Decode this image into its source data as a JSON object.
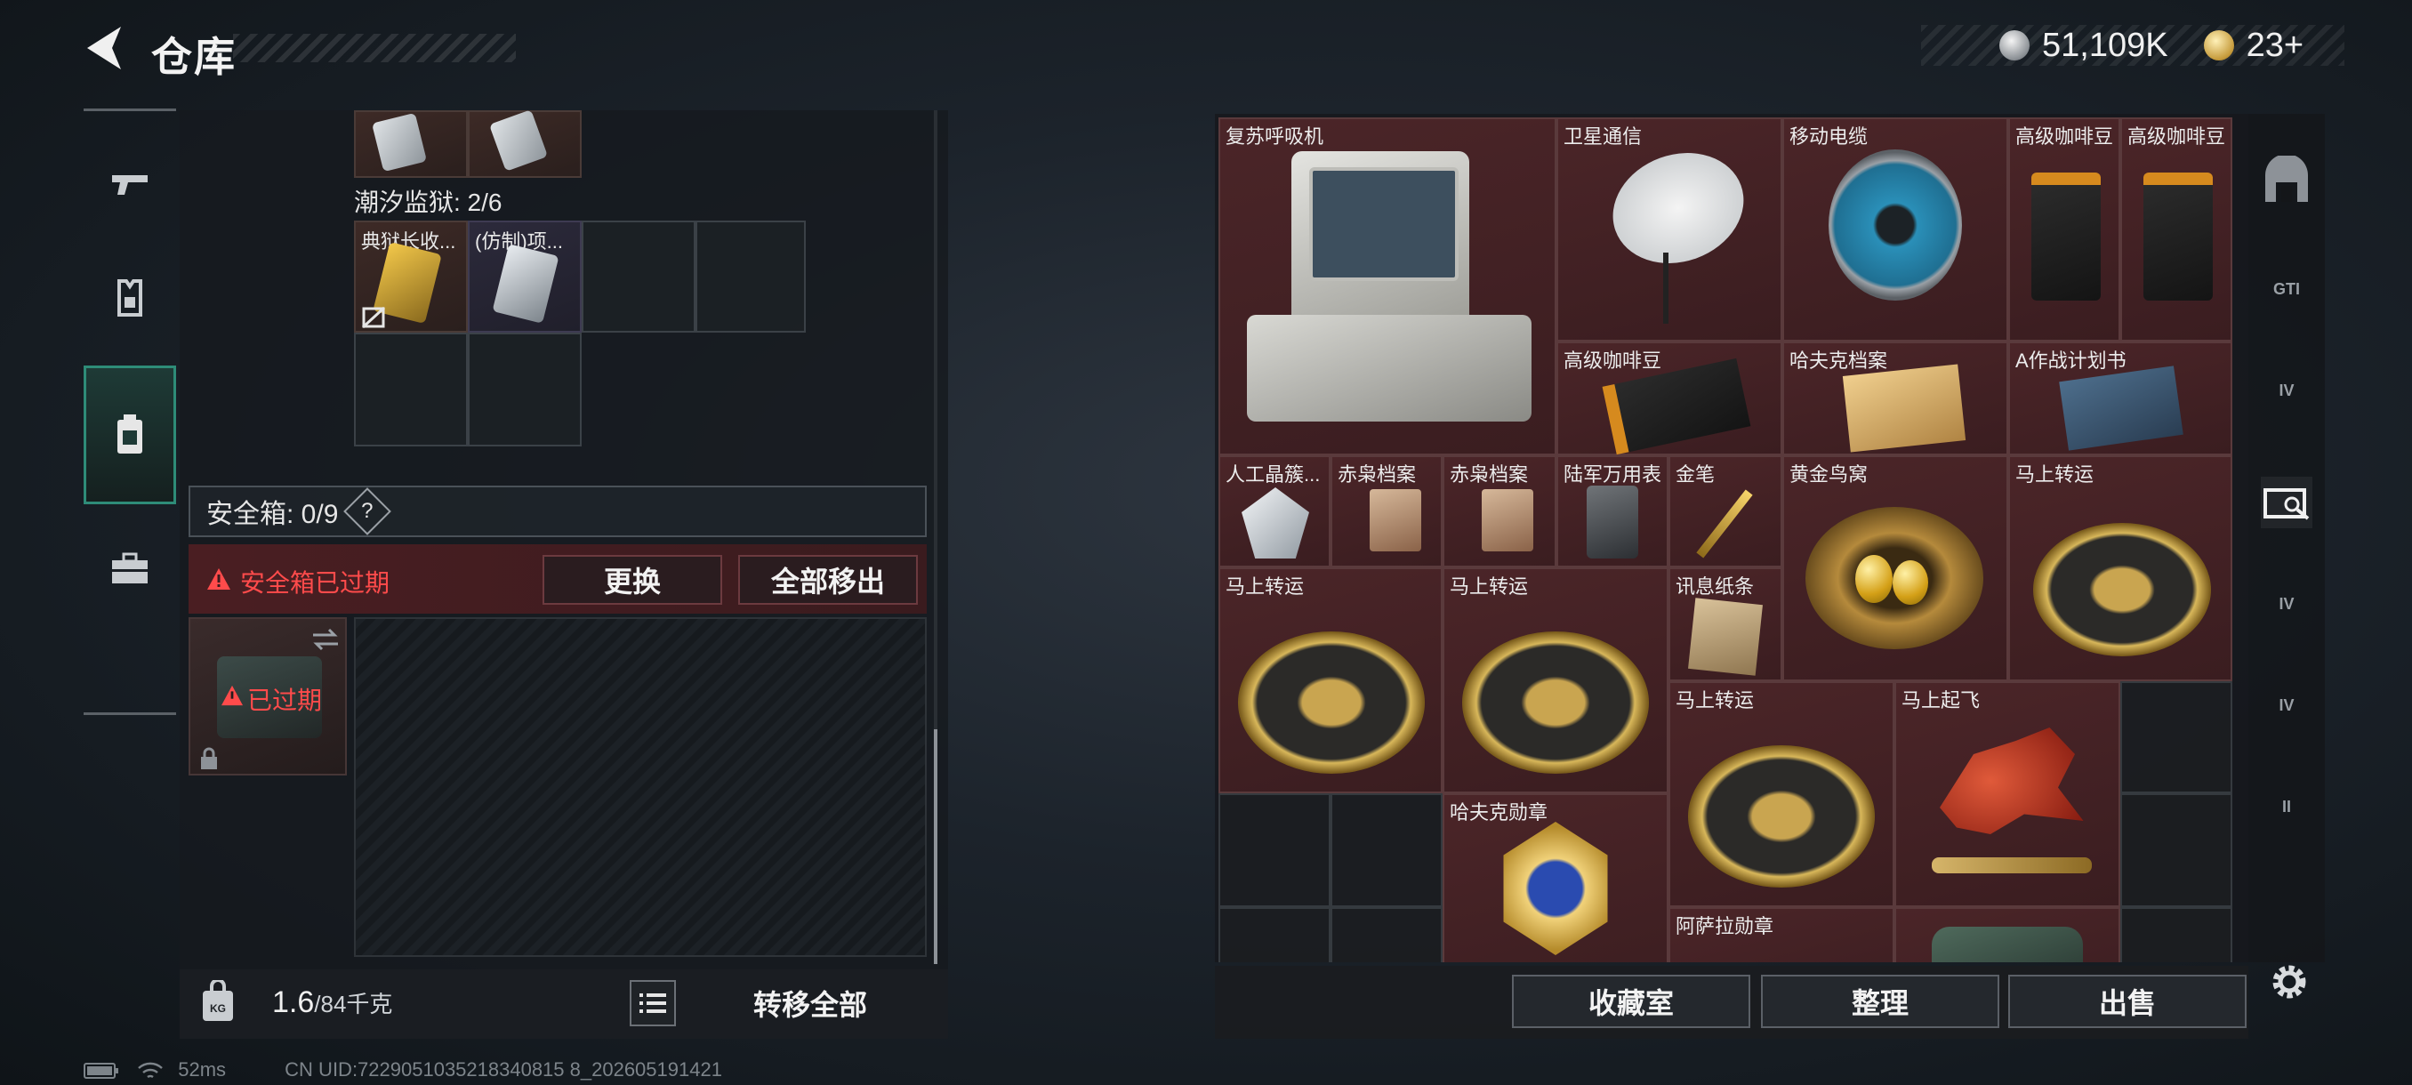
{
  "header": {
    "title": "仓库",
    "silver": "51,109K",
    "gold": "23+"
  },
  "left": {
    "group_label": "潮汐监狱: 2/6",
    "items": [
      "典狱长收...",
      "(仿制)项..."
    ],
    "safe_label": "安全箱: 0/9",
    "safe_help": "?",
    "warning": "安全箱已过期",
    "replace_btn": "更换",
    "moveall_btn": "全部移出",
    "expired_badge": "已过期",
    "weight_current": "1.6",
    "weight_max": "/84千克",
    "transfer_btn": "转移全部"
  },
  "nav": [
    {
      "icon": "gun-icon",
      "active": false
    },
    {
      "icon": "armor-icon",
      "active": false
    },
    {
      "icon": "backpack-icon",
      "active": true
    },
    {
      "icon": "toolbox-icon",
      "active": false
    }
  ],
  "stash": {
    "items": [
      "复苏呼吸机",
      "卫星通信",
      "移动电缆",
      "高级咖啡豆",
      "高级咖啡豆",
      "高级咖啡豆",
      "哈夫克档案",
      "A作战计划书",
      "人工晶簇...",
      "赤枭档案",
      "赤枭档案",
      "陆军万用表",
      "金笔",
      "黄金鸟窝",
      "马上转运",
      "马上转运",
      "马上转运",
      "讯息纸条",
      "马上转运",
      "马上起飞",
      "哈夫克勋章",
      "阿萨拉勋章"
    ],
    "side_tabs": [
      "GTI",
      "IV",
      "IV",
      "IV",
      "II"
    ],
    "buttons": {
      "collection": "收藏室",
      "sort": "整理",
      "sell": "出售"
    }
  },
  "status": {
    "ping": "52ms",
    "uid": "CN UID:7229051035218340815 8_202605191421"
  },
  "colors": {
    "accent_teal": "#2e8c78",
    "warning_red": "#ff4b4b",
    "slot_red": "#4b2528"
  }
}
